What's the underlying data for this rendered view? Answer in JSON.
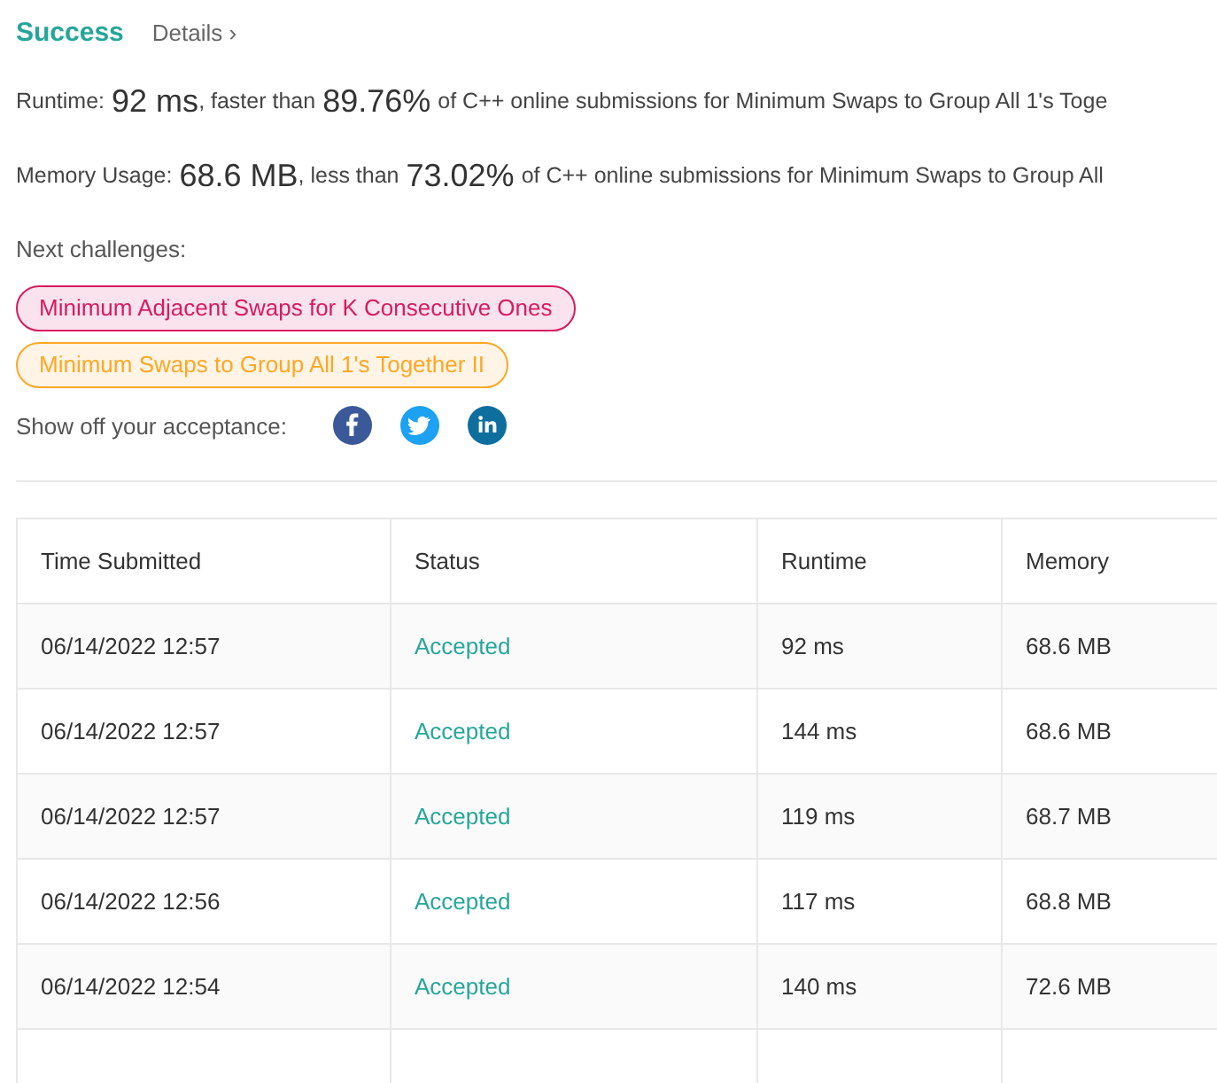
{
  "header": {
    "title": "Success",
    "details_link": "Details",
    "details_caret": "›"
  },
  "stats": [
    {
      "label": "Runtime:",
      "value": "92 ms",
      "comparison": ", faster than",
      "percent": "89.76%",
      "rest": "of C++ online submissions for Minimum Swaps to Group All 1's Toge"
    },
    {
      "label": "Memory Usage:",
      "value": "68.6 MB",
      "comparison": ", less than",
      "percent": "73.02%",
      "rest": "of C++ online submissions for Minimum Swaps to Group All"
    }
  ],
  "next_challenges": {
    "label": "Next challenges:",
    "items": [
      {
        "title": "Minimum Adjacent Swaps for K Consecutive Ones",
        "color": "#d81b60"
      },
      {
        "title": "Minimum Swaps to Group All 1's Together II",
        "color": "#ffa726"
      }
    ]
  },
  "share": {
    "label": "Show off your acceptance:",
    "networks": [
      {
        "kind": "facebook"
      },
      {
        "kind": "twitter"
      },
      {
        "kind": "linkedin"
      }
    ]
  },
  "table": {
    "columns": [
      "Time Submitted",
      "Status",
      "Runtime",
      "Memory"
    ],
    "rows": [
      [
        "06/14/2022 12:57",
        "Accepted",
        "92 ms",
        "68.6 MB"
      ],
      [
        "06/14/2022 12:57",
        "Accepted",
        "144 ms",
        "68.6 MB"
      ],
      [
        "06/14/2022 12:57",
        "Accepted",
        "119 ms",
        "68.7 MB"
      ],
      [
        "06/14/2022 12:56",
        "Accepted",
        "117 ms",
        "68.8 MB"
      ],
      [
        "06/14/2022 12:54",
        "Accepted",
        "140 ms",
        "72.6 MB"
      ]
    ]
  }
}
